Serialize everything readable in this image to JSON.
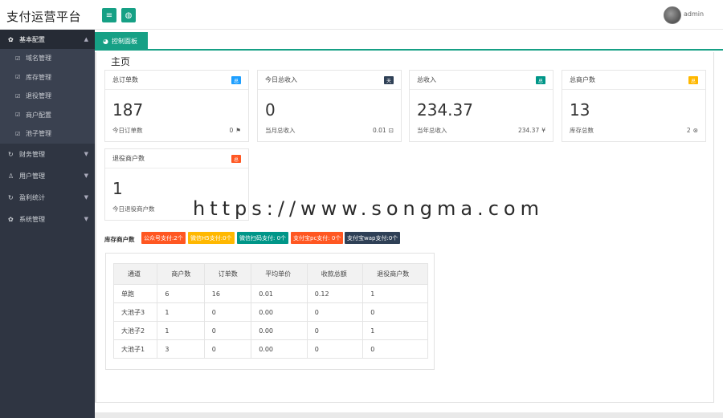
{
  "header": {
    "app_title": "支付运营平台",
    "menu_icon": "menu-icon",
    "globe_icon": "globe-icon",
    "user_name": "admin"
  },
  "sidebar": {
    "groups": [
      {
        "label": "基本配置",
        "icon": "gear-icon",
        "expanded": true,
        "items": [
          {
            "label": "域名管理"
          },
          {
            "label": "库存管理"
          },
          {
            "label": "退役管理"
          },
          {
            "label": "商户配置"
          },
          {
            "label": "池子管理"
          }
        ]
      },
      {
        "label": "财务管理",
        "icon": "refresh-icon",
        "expanded": false
      },
      {
        "label": "用户管理",
        "icon": "user-icon",
        "expanded": false
      },
      {
        "label": "盈利统计",
        "icon": "refresh-icon",
        "expanded": false
      },
      {
        "label": "系统管理",
        "icon": "gear-icon",
        "expanded": false
      }
    ]
  },
  "tabs": [
    {
      "label": "控制面板",
      "icon": "dashboard-icon"
    }
  ],
  "page_title": "主页",
  "cards": [
    {
      "title": "总订单数",
      "badge": "总",
      "badge_color": "#1e9fff",
      "value": "187",
      "foot_label": "今日订单数",
      "foot_value": "0",
      "foot_icon": "flag-icon"
    },
    {
      "title": "今日总收入",
      "badge": "天",
      "badge_color": "#2f4056",
      "value": "0",
      "foot_label": "当月总收入",
      "foot_value": "0.01",
      "foot_icon": "money-icon"
    },
    {
      "title": "总收入",
      "badge": "总",
      "badge_color": "#009688",
      "value": "234.37",
      "foot_label": "当年总收入",
      "foot_value": "234.37",
      "foot_icon": "yen-icon"
    },
    {
      "title": "总商户数",
      "badge": "总",
      "badge_color": "#ffb800",
      "value": "13",
      "foot_label": "库存总数",
      "foot_value": "2",
      "foot_icon": "compass-icon"
    },
    {
      "title": "退役商户数",
      "badge": "总",
      "badge_color": "#ff5722",
      "value": "1",
      "foot_label": "今日退役商户数",
      "foot_value": "",
      "foot_icon": ""
    }
  ],
  "channels": {
    "label": "库存商户数",
    "tags": [
      {
        "text": "公众号支付:2个",
        "color": "#ff5722"
      },
      {
        "text": "微信H5支付:0个",
        "color": "#ffb800"
      },
      {
        "text": "微信扫码支付: 0个",
        "color": "#009688"
      },
      {
        "text": "支付宝pc支付: 0个",
        "color": "#ff5722"
      },
      {
        "text": "支付宝wap支付:0个",
        "color": "#2f4056"
      }
    ]
  },
  "table": {
    "headers": [
      "通道",
      "商户数",
      "订单数",
      "平均单价",
      "收款总额",
      "退役商户数"
    ],
    "rows": [
      [
        "单跑",
        "6",
        "16",
        "0.01",
        "0.12",
        "1"
      ],
      [
        "大池子3",
        "1",
        "0",
        "0.00",
        "0",
        "0"
      ],
      [
        "大池子2",
        "1",
        "0",
        "0.00",
        "0",
        "1"
      ],
      [
        "大池子1",
        "3",
        "0",
        "0.00",
        "0",
        "0"
      ]
    ]
  },
  "watermark": "https://www.songma.com",
  "colors": {
    "accent": "#16a085",
    "sidebar_bg": "#2f3542"
  }
}
